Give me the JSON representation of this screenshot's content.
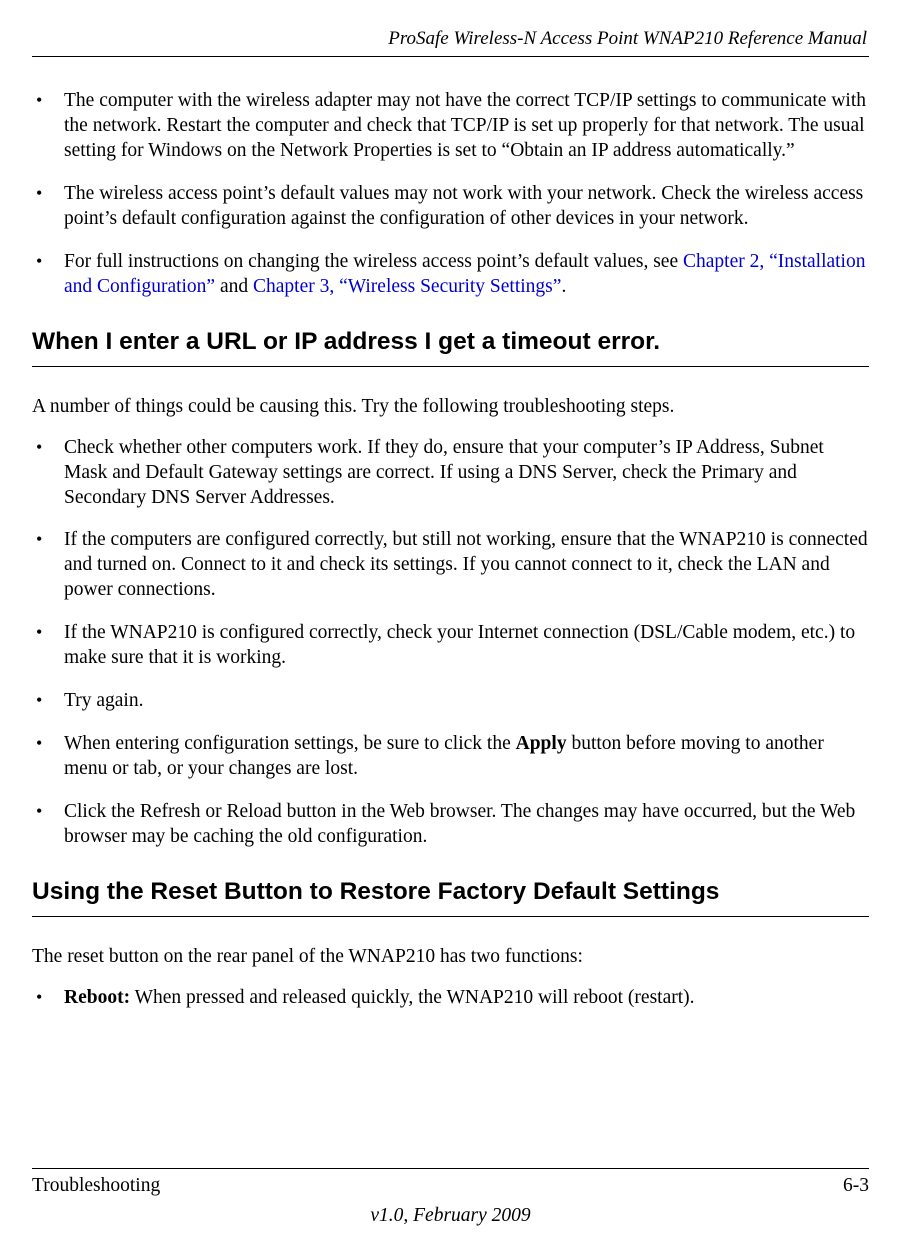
{
  "header": {
    "title": "ProSafe Wireless-N Access Point WNAP210 Reference Manual"
  },
  "topBullets": {
    "b1": "The computer with the wireless adapter may not have the correct TCP/IP settings to communicate with the network. Restart the computer and check that TCP/IP is set up properly for that network. The usual setting for Windows on the Network Properties is set to “Obtain an IP address automatically.”",
    "b2": "The wireless access point’s default values may not work with your network. Check the wireless access point’s default configuration against the configuration of other devices in your network.",
    "b3_pre": "For full instructions on changing the wireless access point’s default values, see ",
    "b3_link1": "Chapter 2, “Installation and Configuration”",
    "b3_mid": " and ",
    "b3_link2": "Chapter 3, “Wireless Security Settings”",
    "b3_post": "."
  },
  "section1": {
    "heading": "When I enter a URL or IP address I get a timeout error.",
    "intro": "A number of things could be causing this. Try the following troubleshooting steps.",
    "bullets": {
      "b1": "Check whether other computers work. If they do, ensure that your computer’s IP Address, Subnet Mask and Default Gateway settings are correct. If using a DNS Server, check the Primary and Secondary DNS Server Addresses.",
      "b2": "If the computers are configured correctly, but still not working, ensure that the WNAP210 is connected and turned on. Connect to it and check its settings. If you cannot connect to it, check the LAN and power connections.",
      "b3": "If the WNAP210 is configured correctly, check your Internet connection (DSL/Cable modem, etc.) to make sure that it is working.",
      "b4": "Try again.",
      "b5_pre": "When entering configuration settings, be sure to click the ",
      "b5_bold": "Apply",
      "b5_post": " button before moving to another menu or tab, or your changes are lost.",
      "b6": "Click the Refresh or Reload button in the Web browser. The changes may have occurred, but the Web browser may be caching the old configuration."
    }
  },
  "section2": {
    "heading": "Using the Reset Button to Restore Factory Default Settings",
    "intro": "The reset button on the rear panel of the WNAP210 has two functions:",
    "bullets": {
      "b1_bold": "Reboot:",
      "b1_post": " When pressed and released quickly, the WNAP210 will reboot (restart)."
    }
  },
  "footer": {
    "left": "Troubleshooting",
    "right": "6-3",
    "version": "v1.0, February 2009"
  }
}
